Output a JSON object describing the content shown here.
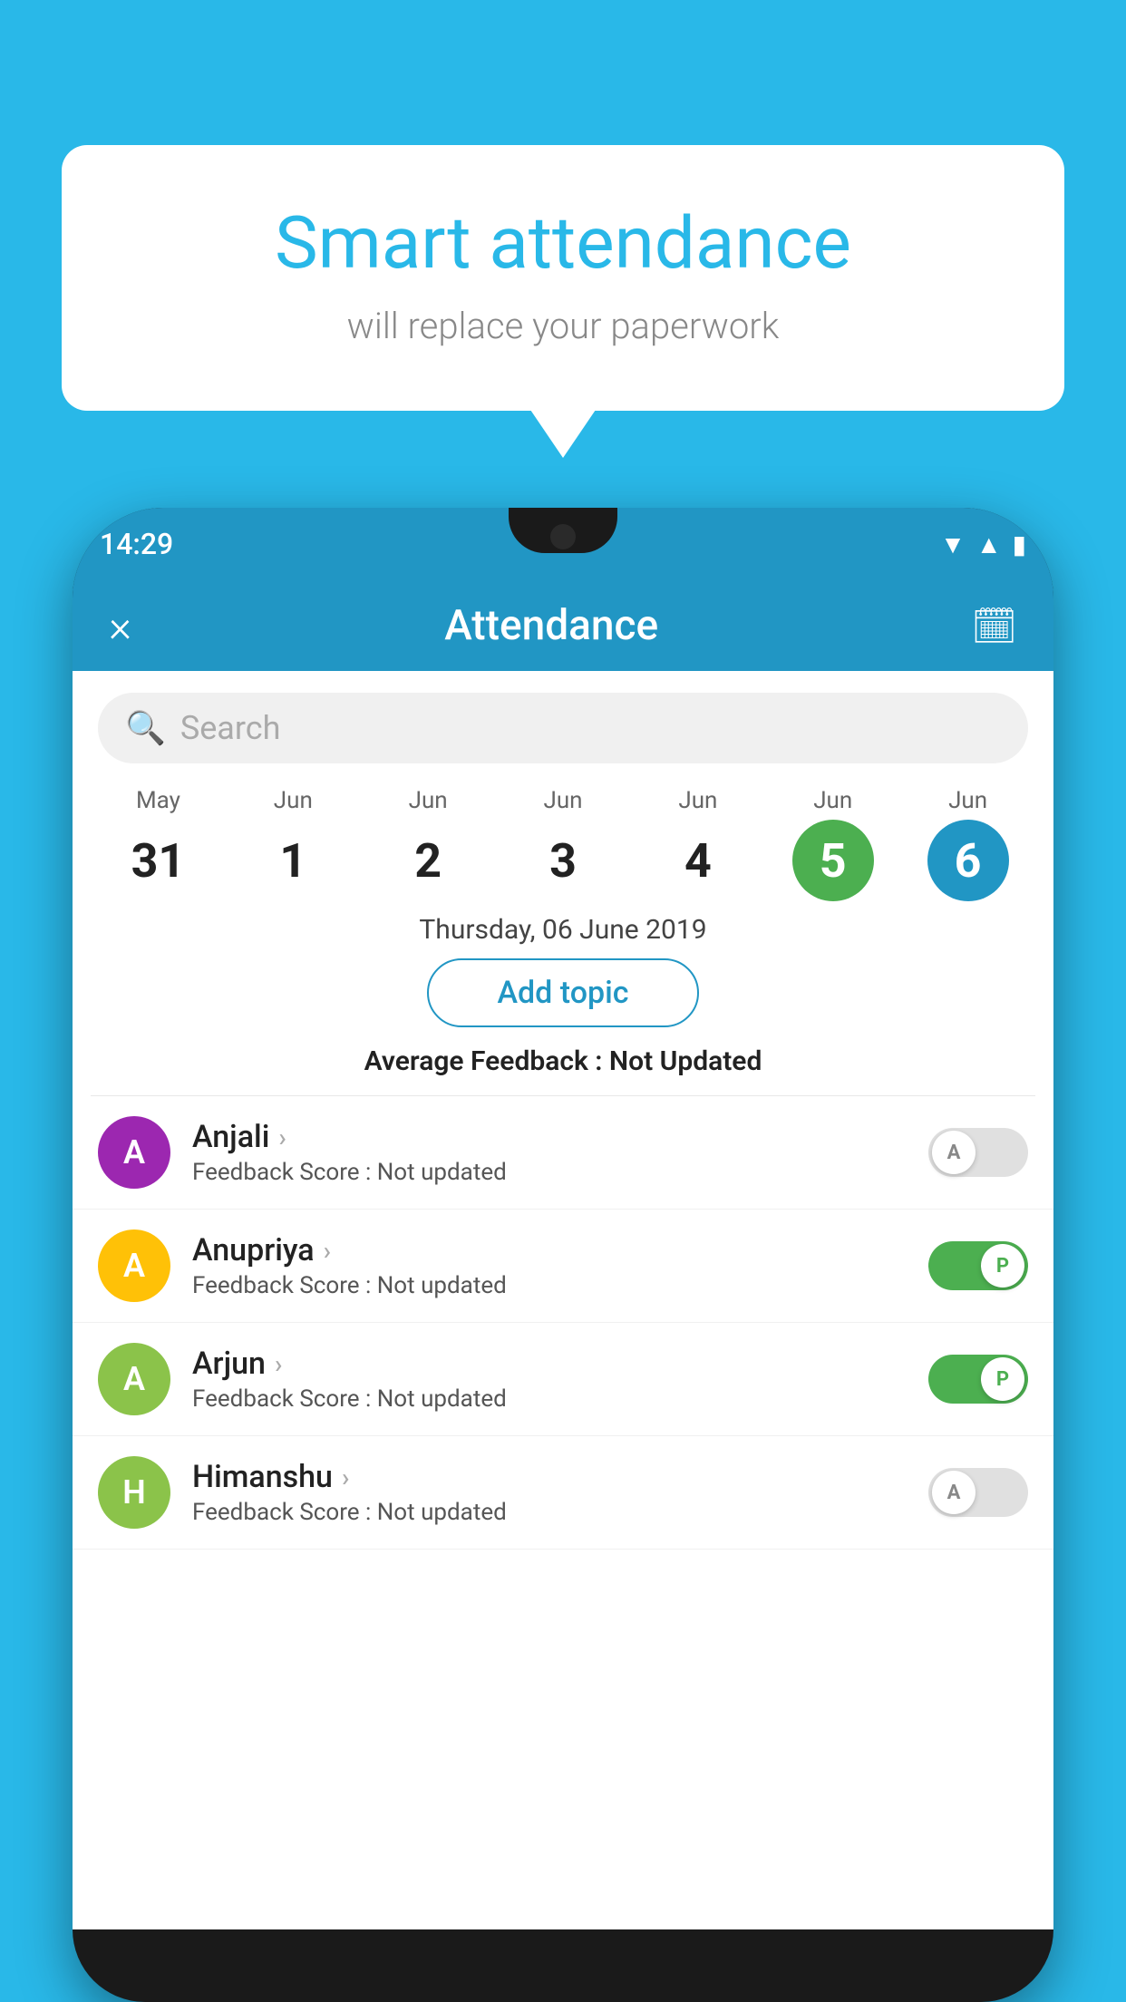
{
  "background_color": "#29b8e8",
  "speech_bubble": {
    "title": "Smart attendance",
    "subtitle": "will replace your paperwork"
  },
  "status_bar": {
    "time": "14:29",
    "wifi_icon": "▼",
    "signal_icon": "▲",
    "battery_icon": "▮"
  },
  "header": {
    "close_label": "×",
    "title": "Attendance",
    "calendar_icon": "📅"
  },
  "search": {
    "placeholder": "Search"
  },
  "calendar": {
    "days": [
      {
        "month": "May",
        "day": "31",
        "state": "normal"
      },
      {
        "month": "Jun",
        "day": "1",
        "state": "normal"
      },
      {
        "month": "Jun",
        "day": "2",
        "state": "normal"
      },
      {
        "month": "Jun",
        "day": "3",
        "state": "normal"
      },
      {
        "month": "Jun",
        "day": "4",
        "state": "normal"
      },
      {
        "month": "Jun",
        "day": "5",
        "state": "today"
      },
      {
        "month": "Jun",
        "day": "6",
        "state": "selected"
      }
    ]
  },
  "selected_date_label": "Thursday, 06 June 2019",
  "add_topic_label": "Add topic",
  "average_feedback": {
    "label": "Average Feedback : ",
    "value": "Not Updated"
  },
  "students": [
    {
      "name": "Anjali",
      "initial": "A",
      "avatar_color": "#9c27b0",
      "feedback_label": "Feedback Score : ",
      "feedback_value": "Not updated",
      "toggle_state": "off",
      "toggle_label": "A"
    },
    {
      "name": "Anupriya",
      "initial": "A",
      "avatar_color": "#ffc107",
      "feedback_label": "Feedback Score : ",
      "feedback_value": "Not updated",
      "toggle_state": "on",
      "toggle_label": "P"
    },
    {
      "name": "Arjun",
      "initial": "A",
      "avatar_color": "#8bc34a",
      "feedback_label": "Feedback Score : ",
      "feedback_value": "Not updated",
      "toggle_state": "on",
      "toggle_label": "P"
    },
    {
      "name": "Himanshu",
      "initial": "H",
      "avatar_color": "#8bc34a",
      "feedback_label": "Feedback Score : ",
      "feedback_value": "Not updated",
      "toggle_state": "off",
      "toggle_label": "A"
    }
  ]
}
